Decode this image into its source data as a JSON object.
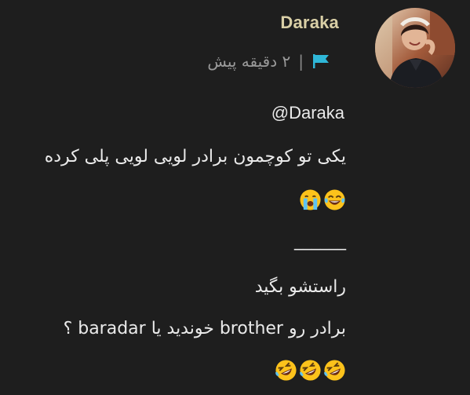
{
  "post": {
    "username": "Daraka",
    "separator": "|",
    "time": "۲ دقیقه پیش",
    "mention": "@Daraka",
    "line1": "یکی تو کوچمون برادر لویی لویی پلی کرده",
    "divider": "______",
    "line2": "راستشو بگید",
    "line3": "برادر رو brother خوندید یا baradar ؟"
  },
  "icons": {
    "flag": "flag-icon",
    "avatar": "user-avatar",
    "row1_emojis": [
      "face-with-tears-of-joy",
      "loudly-crying-face"
    ],
    "row2_emojis": [
      "rolling-on-floor-laughing",
      "rolling-on-floor-laughing",
      "rolling-on-floor-laughing"
    ]
  },
  "colors": {
    "background": "#1e1e1e",
    "username": "#d9cfa6",
    "flag": "#2fb7d8",
    "text": "#eaeaea",
    "muted": "#9a9a9a"
  }
}
